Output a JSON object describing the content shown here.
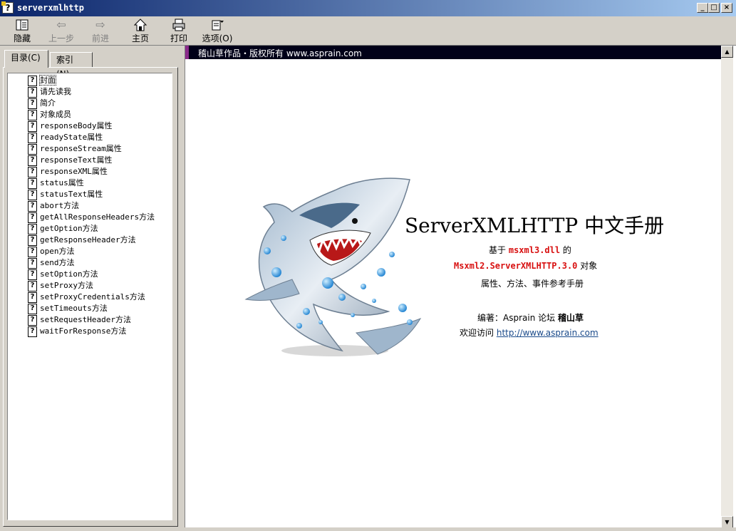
{
  "window": {
    "title": "serverxmlhttp",
    "minimize_glyph": "0",
    "maximize_glyph": "1",
    "close_glyph": "r"
  },
  "toolbar": {
    "hide_label": "隐藏",
    "back_label": "上一步",
    "forward_label": "前进",
    "home_label": "主页",
    "print_label": "打印",
    "options_label": "选项(O)"
  },
  "icons": {
    "hide": "hide-icon",
    "back": "back-arrow-icon",
    "forward": "forward-arrow-icon",
    "home": "home-icon",
    "print": "printer-icon",
    "options": "options-icon",
    "topic": "help-topic-icon"
  },
  "tabs": {
    "contents": "目录(C)",
    "index": "索引(N)"
  },
  "tree": {
    "items": [
      "封面",
      "请先读我",
      "简介",
      "对象成员",
      "responseBody属性",
      "readyState属性",
      "responseStream属性",
      "responseText属性",
      "responseXML属性",
      "status属性",
      "statusText属性",
      "abort方法",
      "getAllResponseHeaders方法",
      "getOption方法",
      "getResponseHeader方法",
      "open方法",
      "send方法",
      "setOption方法",
      "setProxy方法",
      "setProxyCredentials方法",
      "setTimeouts方法",
      "setRequestHeader方法",
      "waitForResponse方法"
    ]
  },
  "content": {
    "banner": "稽山草作品・版权所有 www.asprain.com",
    "heading": "ServerXMLHTTP 中文手册",
    "line1_prefix": "基于",
    "line1_code": "msxml3.dll",
    "line1_suffix": "的",
    "line2_code": "Msxml2.ServerXMLHTTP.3.0",
    "line2_suffix": "对象",
    "line3": "属性、方法、事件参考手册",
    "author_prefix": "编著：Asprain 论坛",
    "author_name": "稽山草",
    "visit_prefix": "欢迎访问",
    "visit_link": "http://www.asprain.com"
  },
  "colors": {
    "titlebar_start": "#0a246a",
    "titlebar_end": "#a6caf0",
    "banner_bg": "#000018",
    "banner_accent": "#8a2a8a",
    "code_red": "#d81010",
    "link_blue": "#1a4a8a"
  }
}
